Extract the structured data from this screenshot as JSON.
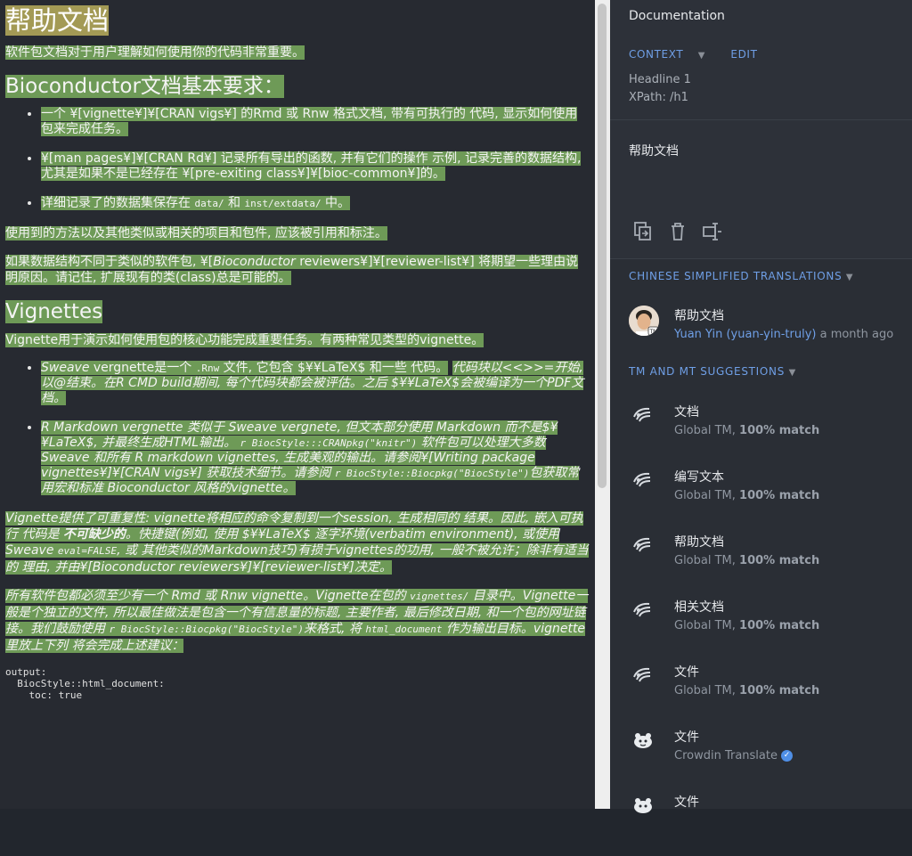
{
  "doc": {
    "title": "帮助文档",
    "intro": "软件包文档对于用户理解如何使用你的代码非常重要。",
    "h_requirements": "Bioconductor文档基本要求：",
    "req_items": [
      "一个 ¥[vignette¥]¥[CRAN vigs¥] 的Rmd 或 Rnw 格式文档, 带有可执行的 代码, 显示如何使用包来完成任务。",
      "¥[man pages¥]¥[CRAN Rd¥] 记录所有导出的函数, 并有它们的操作 示例, 记录完善的数据结构, 尤其是如果不是已经存在 ¥[pre-exiting class¥]¥[bioc-common¥]的。"
    ],
    "req3_prefix": "详细记录了的数据集保存在 ",
    "req3_code1": "data/",
    "req3_mid": " 和 ",
    "req3_code2": "inst/extdata/",
    "req3_suffix": " 中。",
    "p_cite": "使用到的方法以及其他类似或相关的项目和包件, 应该被引用和标注。",
    "p_struct_a": "如果数据结构不同于类似的软件包, ¥[",
    "p_struct_b": "Bioconductor",
    "p_struct_c": " reviewers¥]¥[reviewer-list¥] 将期望一些理由说明原因。请记住, 扩展现有的类(class)总是可能的。",
    "h_vignettes": "Vignettes",
    "p_vig": "Vignette用于演示如何使用包的核心功能完成重要任务。有两种常见类型的vignette。",
    "vig1_a": "Sweave",
    "vig1_b": " vergnette是一个 ",
    "vig1_code": ".Rnw",
    "vig1_c": " 文件, 它包含 $¥¥LaTeX$ 和一些 代码。",
    "vig1_d": "代码块以<<>>=开始, 以@结束。在R CMD build期间, 每个代码块都会被评估。之后 $¥¥LaTeX$会被编译为一个PDF文档。",
    "vig2_a": "R Markdown vergnette 类似于 Sweave vergnete, 但文本部分使用 Markdown 而不是$¥¥LaTeX$, 并最终生成HTML输出。",
    "vig2_code1": "r BiocStyle:::CRANpkg(\"knitr\")",
    "vig2_b": " 软件包可以处理大多数 Sweave 和所有 R markdown vignettes, 生成美观的输出。请参阅¥[Writing package vignettes¥]¥[CRAN vigs¥] 获取技术细节。请参阅 ",
    "vig2_code2": "r BiocStyle::Biocpkg(\"BiocStyle\")",
    "vig2_c": "包获取常用宏和标准 Bioconductor 风格的vignette。",
    "p_repro_a": "Vignette提供了可重复性: vignette将相应的命令复制到一个session, 生成相同的 结果。因此, 嵌入可执行 代码是 ",
    "p_repro_b": "不可缺少的",
    "p_repro_c": "。快捷键(例如, 使用 $¥¥LaTeX$ 逐字环境(verbatim environment), 或使用 Sweave ",
    "p_repro_code": "eval=FALSE",
    "p_repro_d": ", 或 其他类似的Markdown技巧)有损于vignettes的功用, 一般不被允许；除非有适当的 理由, 并由¥[Bioconductor reviewers¥]¥[reviewer-list¥]决定。",
    "p_all_a": "所有软件包都必须至少有一个 Rmd 或 Rnw vignette。Vignette在包的 ",
    "p_all_code1": "vignettes/",
    "p_all_b": " 目录中。Vignette一般是个独立的文件, 所以最佳做法是包含一个有信息量的标题, 主要作者, 最后修改日期, 和一个包的网址链接。我们鼓励使用 ",
    "p_all_code2": "r BiocStyle::Biocpkg(\"BiocStyle\")",
    "p_all_c": "来格式, 将 ",
    "p_all_code3": "html_document",
    "p_all_d": " 作为输出目标。vignette里放上下列 将会完成上述建议：",
    "code_block": "output:\n  BiocStyle::html_document:\n    toc: true"
  },
  "sidebar": {
    "title": "Documentation",
    "context_label": "CONTEXT",
    "edit_label": "EDIT",
    "context_type": "Headline 1",
    "xpath": "XPath: /h1",
    "source_text": "帮助文档",
    "translations_head": "CHINESE SIMPLIFIED TRANSLATIONS",
    "translation": {
      "text": "帮助文档",
      "user": "Yuan Yin (yuan-yin-truly)",
      "time": "a month ago"
    },
    "suggestions_head": "TM AND MT SUGGESTIONS",
    "suggestions": [
      {
        "text": "文档",
        "source": "Global TM, ",
        "match": "100% match"
      },
      {
        "text": "编写文本",
        "source": "Global TM, ",
        "match": "100% match"
      },
      {
        "text": "帮助文档",
        "source": "Global TM, ",
        "match": "100% match"
      },
      {
        "text": "相关文档",
        "source": "Global TM, ",
        "match": "100% match"
      },
      {
        "text": "文件",
        "source": "Global TM, ",
        "match": "100% match"
      },
      {
        "text": "文件",
        "source": "Crowdin Translate",
        "match": ""
      },
      {
        "text": "文件",
        "source": "",
        "match": ""
      }
    ],
    "icons": {
      "copy": "copy-source-icon",
      "delete": "delete-icon",
      "split": "split-icon",
      "tm": "global-tm-icon",
      "mt": "crowdin-translate-icon",
      "verified": "verified-check-icon"
    }
  }
}
